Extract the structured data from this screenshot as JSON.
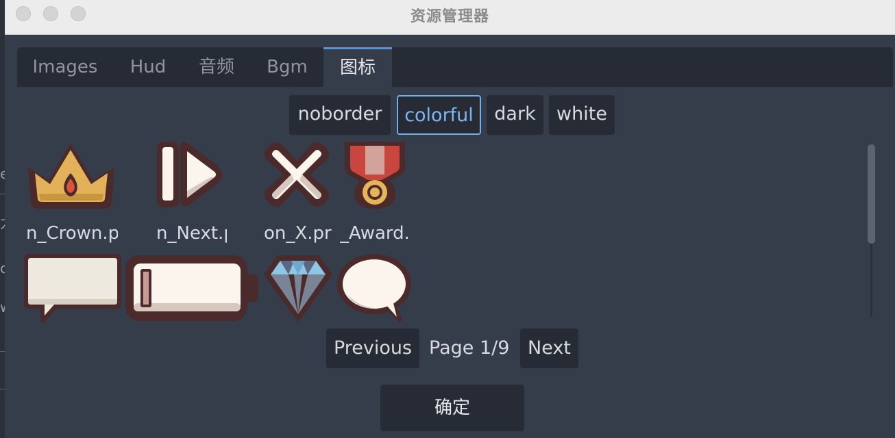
{
  "window": {
    "title": "资源管理器"
  },
  "tabs": [
    {
      "label": "Images",
      "active": false
    },
    {
      "label": "Hud",
      "active": false
    },
    {
      "label": "音频",
      "active": false
    },
    {
      "label": "Bgm",
      "active": false
    },
    {
      "label": "图标",
      "active": true
    }
  ],
  "filters": {
    "noborder": "noborder",
    "colorful": "colorful",
    "dark": "dark",
    "white": "white",
    "selected": "colorful"
  },
  "icons": [
    {
      "caption": "n_Crown.p",
      "icon": "crown-icon"
    },
    {
      "caption": "n_Next.p",
      "icon": "next-icon"
    },
    {
      "caption": "on_X.pr",
      "icon": "x-icon"
    },
    {
      "caption": "_Award.",
      "icon": "award-medal-icon"
    },
    {
      "caption": "",
      "icon": "speech-banner-icon"
    },
    {
      "caption": "",
      "icon": "battery-bar-icon"
    },
    {
      "caption": "",
      "icon": "diamond-icon"
    },
    {
      "caption": "",
      "icon": "speech-bubble-icon"
    }
  ],
  "pagination": {
    "previous": "Previous",
    "page_text": "Page 1/9",
    "next": "Next"
  },
  "confirm_label": "确定",
  "backdrop_fragments": [
    "e",
    "力",
    "c",
    "w"
  ],
  "colors": {
    "panel": "#363d4a",
    "tabbar": "#262b35",
    "accent": "#78aee8",
    "icon_outline": "#4a2a2a"
  }
}
